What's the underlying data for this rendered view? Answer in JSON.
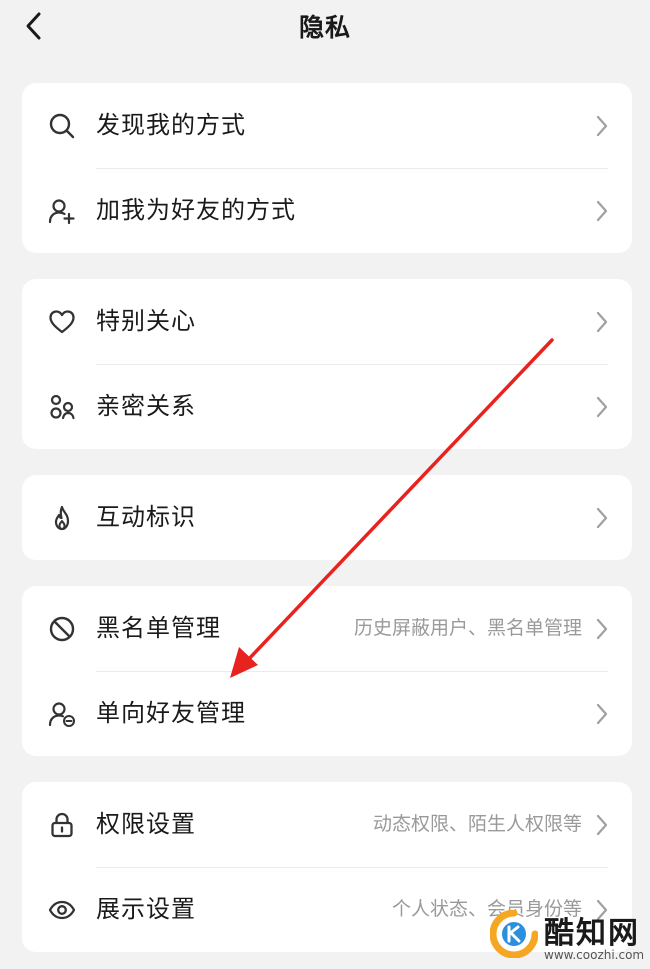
{
  "header": {
    "back_icon": "chevron-left-icon",
    "title": "隐私"
  },
  "groups": [
    {
      "items": [
        {
          "icon": "search-icon",
          "label": "发现我的方式",
          "sub": ""
        },
        {
          "icon": "add-user-icon",
          "label": "加我为好友的方式",
          "sub": ""
        }
      ]
    },
    {
      "items": [
        {
          "icon": "heart-icon",
          "label": "特别关心",
          "sub": ""
        },
        {
          "icon": "intimate-relation-icon",
          "label": "亲密关系",
          "sub": ""
        }
      ]
    },
    {
      "items": [
        {
          "icon": "flame-icon",
          "label": "互动标识",
          "sub": ""
        }
      ]
    },
    {
      "items": [
        {
          "icon": "block-icon",
          "label": "黑名单管理",
          "sub": "历史屏蔽用户、黑名单管理"
        },
        {
          "icon": "one-way-friend-icon",
          "label": "单向好友管理",
          "sub": ""
        }
      ]
    },
    {
      "items": [
        {
          "icon": "lock-icon",
          "label": "权限设置",
          "sub": "动态权限、陌生人权限等"
        },
        {
          "icon": "eye-icon",
          "label": "展示设置",
          "sub": "个人状态、会员身份等"
        }
      ]
    }
  ],
  "annotation": {
    "arrow_color": "#e8231f",
    "points_to": "单向好友管理"
  },
  "watermark": {
    "name": "酷知网",
    "url": "www.coozhi.com",
    "colors": [
      "#f5a623",
      "#2b8fe0"
    ]
  }
}
